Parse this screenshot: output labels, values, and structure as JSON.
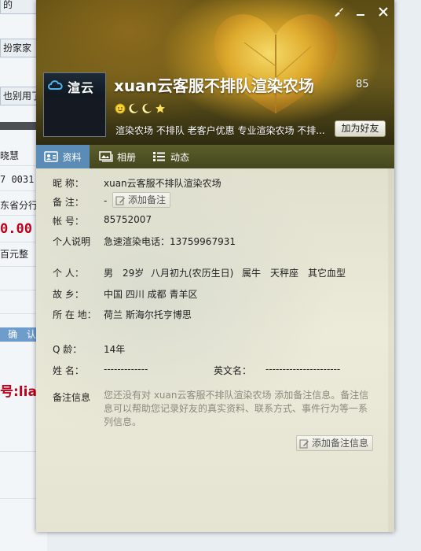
{
  "background_app": {
    "rows": [
      "的",
      "扮家家",
      "也别用了",
      "晓慧",
      "7 0031",
      "东省分行",
      "0.00",
      "百元整"
    ],
    "confirm_label": "确 认",
    "red_text": "号:lia"
  },
  "window": {
    "skin_icon": "brush-icon",
    "minimize_icon": "minimize-icon",
    "close_icon": "close-icon"
  },
  "profile": {
    "avatar_text": "渲云",
    "display_name": "xuan云客服不排队渲染农场",
    "uin_short": "85",
    "badges": [
      "smile-icon",
      "moon-icon",
      "moon-icon",
      "star-icon"
    ],
    "signature": "渲染农场 不排队 老客户优惠 专业渲染农场 不排...",
    "add_friend_label": "加为好友"
  },
  "tabs": [
    {
      "label": "资料",
      "icon": "profile-card-icon",
      "active": true
    },
    {
      "label": "相册",
      "icon": "photo-album-icon",
      "active": false
    },
    {
      "label": "动态",
      "icon": "feed-list-icon",
      "active": false
    }
  ],
  "details": {
    "nickname_label": "昵    称：",
    "nickname": "xuan云客服不排队渲染农场",
    "remark_label": "备    注：",
    "remark_value": "-",
    "add_remark_label": "添加备注",
    "account_label": "帐    号：",
    "account": "85752007",
    "bio_label": "个人说明",
    "bio": "急速渲染电话：13759967931",
    "personal_label": "个    人：",
    "gender": "男",
    "age": "29岁",
    "birthday": "八月初九(农历生日)",
    "zodiac": "属牛",
    "constellation": "天秤座",
    "blood_type": "其它血型",
    "hometown_label": "故    乡：",
    "hometown": "中国 四川 成都 青羊区",
    "location_label": "所 在 地：",
    "location": "荷兰 斯海尔托亨博思",
    "qage_label": "Q    龄：",
    "qage": "14年",
    "surname_label": "姓    名：",
    "surname": "-------------",
    "english_name_label": "英文名：",
    "english_name": "----------------------",
    "note_label": "备注信息",
    "note_text": "您还没有对 xuan云客服不排队渲染农场 添加备注信息。备注信息可以帮助您记录好友的真实资料、联系方式、事件行为等一系列信息。",
    "add_note_label": "添加备注信息"
  },
  "colors": {
    "tab_active": "#5b8cb6",
    "tab_bar": "#4f5124",
    "red_text": "#c0001a"
  }
}
